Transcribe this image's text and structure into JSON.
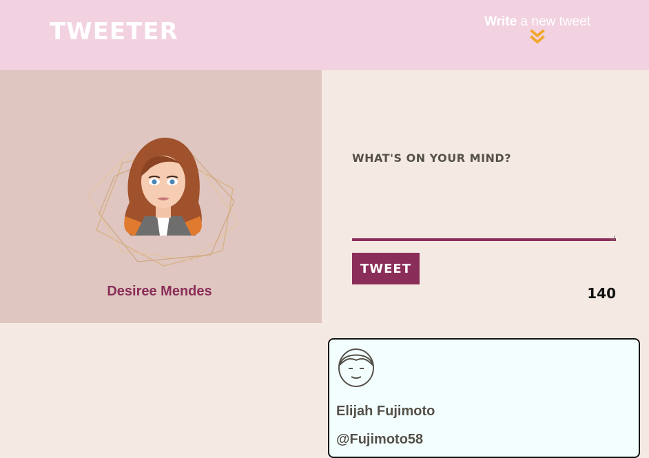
{
  "nav": {
    "brand": "TWEETER",
    "compose_bold": "Write",
    "compose_rest": " a new tweet",
    "chevron_icon": "double-chevron-down-icon",
    "chevron_color": "#f0a830"
  },
  "profile": {
    "name": "Desiree Mendes",
    "avatar_icon": "avatar-image"
  },
  "composer": {
    "prompt": "What's on your mind?",
    "placeholder": "",
    "button_label": "Tweet",
    "counter": "140"
  },
  "tweets": [
    {
      "name": "Elijah Fujimoto",
      "handle": "@Fujimoto58",
      "avatar_icon": "face-outline-icon"
    }
  ],
  "colors": {
    "nav_bg": "#f2d2e0",
    "profile_bg": "#dfc6c1",
    "page_bg": "#f5eae3",
    "accent": "#8a2e59",
    "card_bg": "#f3fefe"
  }
}
